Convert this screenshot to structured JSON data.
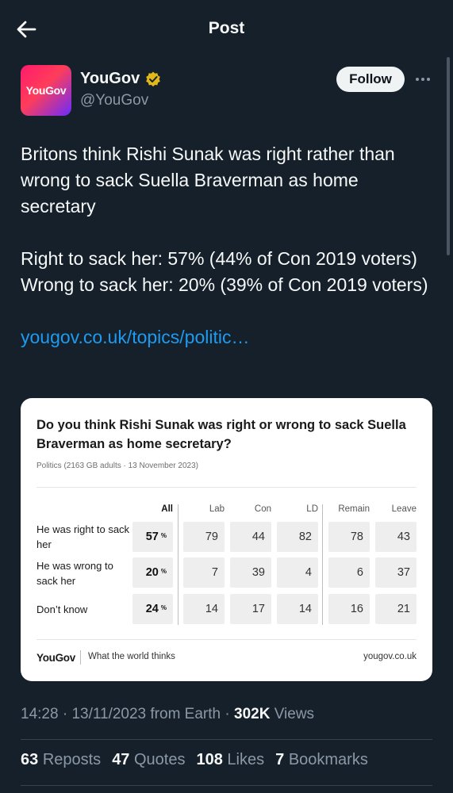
{
  "header": {
    "title": "Post"
  },
  "author": {
    "avatar_text": "YouGov",
    "name": "YouGov",
    "handle": "@YouGov",
    "follow_label": "Follow",
    "avatar_gradient": [
      "#ff1b6b",
      "#6a2bff"
    ],
    "verified_color": "#e2b719"
  },
  "tweet": {
    "line1": "Britons think Rishi Sunak was right rather than wrong to sack Suella Braverman as home secretary",
    "line2": "Right to sack her: 57% (44% of Con 2019 voters)",
    "line3": "Wrong to sack her: 20% (39% of Con 2019 voters)",
    "link": "yougov.co.uk/topics/politic…"
  },
  "card": {
    "title": "Do you think Rishi Sunak was right or wrong to sack Suella Braverman as home secretary?",
    "subtitle": "Politics (2163 GB adults · 13 November 2023)",
    "columns": [
      "All",
      "Lab",
      "Con",
      "LD",
      "Remain",
      "Leave"
    ],
    "rows": [
      {
        "label": "He was right to sack her",
        "all": "57",
        "values": [
          "79",
          "44",
          "82",
          "78",
          "43"
        ]
      },
      {
        "label": "He was wrong to sack her",
        "all": "20",
        "values": [
          "7",
          "39",
          "4",
          "6",
          "37"
        ]
      },
      {
        "label": "Don’t know",
        "all": "24",
        "values": [
          "14",
          "17",
          "14",
          "16",
          "21"
        ]
      }
    ],
    "pct_symbol": "%",
    "footer_logo": "YouGov",
    "footer_tagline": "What the world thinks",
    "footer_url": "yougov.co.uk"
  },
  "meta": {
    "time": "14:28",
    "date": "13/11/2023",
    "source": "from Earth",
    "views_count": "302K",
    "views_label": "Views"
  },
  "stats": [
    {
      "count": "63",
      "label": "Reposts"
    },
    {
      "count": "47",
      "label": "Quotes"
    },
    {
      "count": "108",
      "label": "Likes"
    },
    {
      "count": "7",
      "label": "Bookmarks"
    }
  ],
  "colors": {
    "background": "#15202b",
    "link": "#1d9bf0",
    "muted": "#8b98a5",
    "text": "#f7f9f9"
  }
}
